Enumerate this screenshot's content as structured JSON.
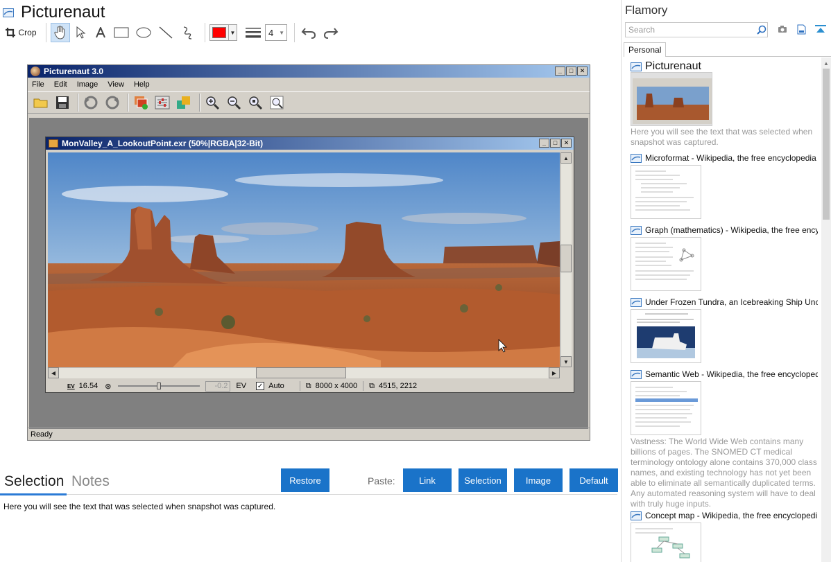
{
  "app": {
    "title": "Picturenaut",
    "toolbar": {
      "crop_label": "Crop",
      "line_width_value": "4",
      "color": "#ff0000"
    }
  },
  "snapshot": {
    "window_title": "Picturenaut 3.0",
    "menu": [
      "File",
      "Edit",
      "Image",
      "View",
      "Help"
    ],
    "status": "Ready",
    "document": {
      "title": "MonValley_A_LookoutPoint.exr (50%|RGBA|32-Bit)",
      "ev_label": "16.54",
      "ev_value": "-0.2",
      "ev_unit": "EV",
      "auto_label": "Auto",
      "dimensions": "8000 x 4000",
      "cursor_pos": "4515, 2212"
    }
  },
  "bottom": {
    "tab_selection": "Selection",
    "tab_notes": "Notes",
    "restore_label": "Restore",
    "paste_label": "Paste:",
    "paste_buttons": [
      "Link",
      "Selection",
      "Image",
      "Default"
    ],
    "selection_text": "Here you will see the text that was selected when snapshot was captured."
  },
  "flamory": {
    "title": "Flamory",
    "search_placeholder": "Search",
    "tab_personal": "Personal",
    "items": [
      {
        "title": "Picturenaut",
        "desc": "Here you will see the text that was selected when snapshot was captured."
      },
      {
        "title": "Microformat - Wikipedia, the free encyclopedia",
        "desc": ""
      },
      {
        "title": "Graph (mathematics) - Wikipedia, the free ency",
        "desc": ""
      },
      {
        "title": "Under Frozen Tundra, an Icebreaking Ship Unco",
        "desc": ""
      },
      {
        "title": "Semantic Web - Wikipedia, the free encycloped",
        "desc": "Vastness: The World Wide Web contains many billions of pages. The SNOMED CT medical terminology ontology alone contains 370,000 class names, and existing technology has not yet been able to eliminate all semantically duplicated terms. Any automated reasoning system will have to deal with truly huge inputs."
      },
      {
        "title": "Concept map - Wikipedia, the free encyclopedi",
        "desc": ""
      }
    ]
  },
  "colors": {
    "accent": "#1a73c9",
    "tab_underline": "#2b7bd6",
    "titlebar_start": "#0a246a",
    "titlebar_end": "#a6caf0"
  }
}
